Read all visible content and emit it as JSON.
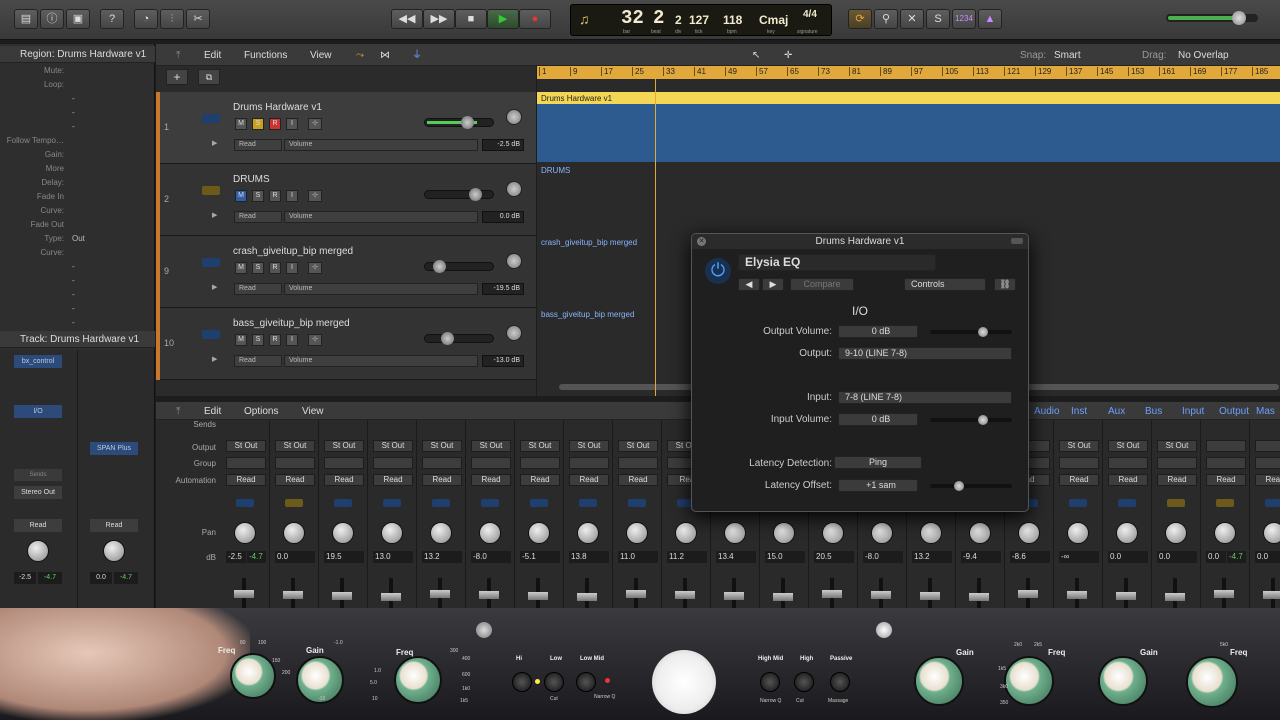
{
  "toolbar": {
    "transport": {
      "rewind_label": "◀◀",
      "forward_label": "▶▶",
      "stop_label": "■",
      "play_label": "▶",
      "record_label": "●"
    },
    "lcd": {
      "bar": "32",
      "beat": "2",
      "div": "2",
      "tick": "127",
      "bpm": "118",
      "key": "Cmaj",
      "signature": "4/4",
      "bar_label": "bar",
      "beat_label": "beat",
      "div_label": "div",
      "tick_label": "tick",
      "bpm_label": "bpm",
      "key_label": "key",
      "signature_label": "signature"
    },
    "count_in": "1234"
  },
  "inspector": {
    "region_header": "Region: Drums Hardware v1",
    "rows": [
      {
        "k": "Mute:",
        "v": ""
      },
      {
        "k": "Loop:",
        "v": ""
      },
      {
        "k": "",
        "v": "-"
      },
      {
        "k": "",
        "v": "-"
      },
      {
        "k": "",
        "v": "-"
      },
      {
        "k": "Follow Tempo…",
        "v": ""
      },
      {
        "k": "Gain:",
        "v": ""
      },
      {
        "k": "More",
        "v": ""
      },
      {
        "k": "Delay:",
        "v": ""
      },
      {
        "k": "Fade In",
        "v": ""
      },
      {
        "k": "Curve:",
        "v": ""
      },
      {
        "k": "Fade Out",
        "v": ""
      },
      {
        "k": "Type:",
        "v": "Out"
      },
      {
        "k": "Curve:",
        "v": ""
      },
      {
        "k": "",
        "v": "-"
      },
      {
        "k": "",
        "v": "-"
      },
      {
        "k": "",
        "v": "-"
      },
      {
        "k": "",
        "v": "-"
      },
      {
        "k": "",
        "v": "-"
      }
    ],
    "track_header": "Track: Drums Hardware v1",
    "strip1": {
      "insert": "bx_control",
      "io": "I/O",
      "sends": "Sends",
      "output": "Stereo Out",
      "automation": "Read",
      "pan_db": "-2.5",
      "peak": "-4.7"
    },
    "strip2": {
      "insert": "SPAN Plus",
      "automation": "Read",
      "pan_db": "0.0",
      "peak": "-4.7"
    }
  },
  "arrange_menu": {
    "edit": "Edit",
    "functions": "Functions",
    "view": "View",
    "snap_label": "Snap:",
    "snap_value": "Smart",
    "drag_label": "Drag:",
    "drag_value": "No Overlap"
  },
  "ruler_marks": [
    "1",
    "9",
    "17",
    "25",
    "33",
    "41",
    "49",
    "57",
    "65",
    "73",
    "81",
    "89",
    "97",
    "105",
    "113",
    "121",
    "129",
    "137",
    "145",
    "153",
    "161",
    "169",
    "177",
    "185"
  ],
  "tracks": [
    {
      "num": "1",
      "name": "Drums Hardware v1",
      "automation": "Read",
      "param": "Volume",
      "db": "-2.5 dB",
      "region": "Drums Hardware v1"
    },
    {
      "num": "2",
      "name": "DRUMS",
      "automation": "Read",
      "param": "Volume",
      "db": "0.0 dB",
      "region": "DRUMS"
    },
    {
      "num": "9",
      "name": "crash_giveitup_bip merged",
      "automation": "Read",
      "param": "Volume",
      "db": "-19.5 dB",
      "region": "crash_giveitup_bip merged"
    },
    {
      "num": "10",
      "name": "bass_giveitup_bip merged",
      "automation": "Read",
      "param": "Volume",
      "db": "-13.0 dB",
      "region": "bass_giveitup_bip merged"
    }
  ],
  "track_buttons": {
    "m": "M",
    "s": "S",
    "r": "R",
    "i": "I"
  },
  "mixer_menu": {
    "edit": "Edit",
    "options": "Options",
    "view": "View",
    "filters": [
      "Audio",
      "Inst",
      "Aux",
      "Bus",
      "Input",
      "Output",
      "Mas"
    ]
  },
  "mixer_labels": {
    "sends": "Sends",
    "output": "Output",
    "group": "Group",
    "automation": "Automation",
    "pan": "Pan",
    "db": "dB"
  },
  "mixer_strips": [
    {
      "out": "St Out",
      "auto": "Read",
      "db": "-2.5",
      "peak": "-4.7"
    },
    {
      "out": "St Out",
      "auto": "Read",
      "db": "0.0",
      "peak": ""
    },
    {
      "out": "St Out",
      "auto": "Read",
      "db": "19.5",
      "peak": ""
    },
    {
      "out": "St Out",
      "auto": "Read",
      "db": "13.0",
      "peak": ""
    },
    {
      "out": "St Out",
      "auto": "Read",
      "db": "13.2",
      "peak": ""
    },
    {
      "out": "St Out",
      "auto": "Read",
      "db": "-8.0",
      "peak": ""
    },
    {
      "out": "St Out",
      "auto": "Read",
      "db": "-5.1",
      "peak": ""
    },
    {
      "out": "St Out",
      "auto": "Read",
      "db": "13.8",
      "peak": ""
    },
    {
      "out": "St Out",
      "auto": "Read",
      "db": "11.0",
      "peak": ""
    },
    {
      "out": "St Out",
      "auto": "Rea",
      "db": "11.2",
      "peak": ""
    },
    {
      "out": "",
      "auto": "",
      "db": "13.4",
      "peak": ""
    },
    {
      "out": "",
      "auto": "",
      "db": "15.0",
      "peak": ""
    },
    {
      "out": "",
      "auto": "",
      "db": "20.5",
      "peak": ""
    },
    {
      "out": "",
      "auto": "",
      "db": "-8.0",
      "peak": ""
    },
    {
      "out": "",
      "auto": "",
      "db": "13.2",
      "peak": ""
    },
    {
      "out": "",
      "auto": "",
      "db": "-9.4",
      "peak": ""
    },
    {
      "out": "",
      "auto": "ad",
      "db": "-8.6",
      "peak": ""
    },
    {
      "out": "St Out",
      "auto": "Read",
      "db": "-∞",
      "peak": ""
    },
    {
      "out": "St Out",
      "auto": "Read",
      "db": "0.0",
      "peak": ""
    },
    {
      "out": "St Out",
      "auto": "Read",
      "db": "0.0",
      "peak": ""
    },
    {
      "out": "",
      "auto": "Read",
      "db": "0.0",
      "peak": "-4.7"
    },
    {
      "out": "",
      "auto": "Read",
      "db": "0.0",
      "peak": ""
    }
  ],
  "plugin": {
    "title": "Drums Hardware v1",
    "preset": "Elysia EQ",
    "compare": "Compare",
    "view": "Controls",
    "section": "I/O",
    "output_volume_label": "Output Volume:",
    "output_volume": "0 dB",
    "output_label": "Output:",
    "output": "9-10  (LINE 7-8)",
    "input_label": "Input:",
    "input": "7-8  (LINE 7-8)",
    "input_volume_label": "Input Volume:",
    "input_volume": "0 dB",
    "latency_detection_label": "Latency Detection:",
    "ping": "Ping",
    "latency_offset_label": "Latency Offset:",
    "latency_offset": "+1 sam"
  },
  "hardware": {
    "labels": [
      "Freq",
      "Gain",
      "Freq",
      "Hi",
      "Low",
      "Low Mid",
      "High Mid",
      "High",
      "Passive",
      "Gain",
      "Freq",
      "Gain",
      "Freq"
    ],
    "ticks": [
      "80",
      "100",
      "150",
      "200",
      "300",
      "400",
      "600",
      "1k0",
      "1k5",
      "-1.0",
      "1.0",
      "5.0",
      "10",
      "-10",
      "Narrow Q",
      "Narrow Q",
      "Cut",
      "Cut",
      "Massage",
      "2k0",
      "2k5",
      "1k5",
      "5k0",
      "3k0",
      "350"
    ]
  }
}
